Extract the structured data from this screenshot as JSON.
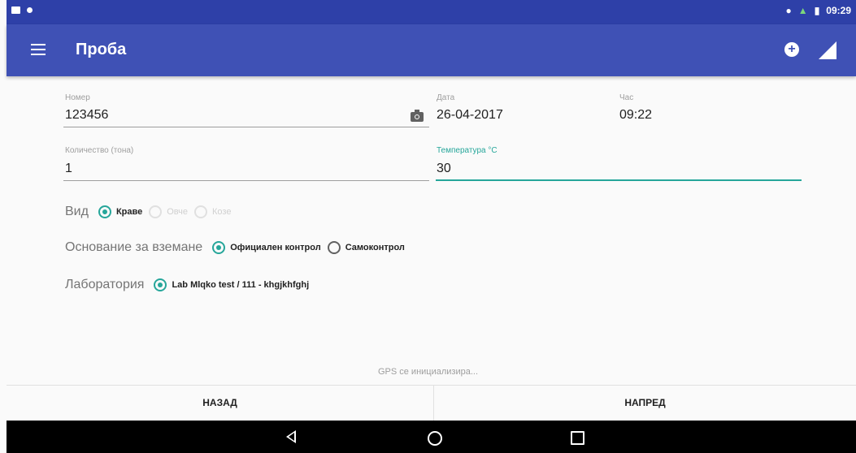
{
  "status_bar": {
    "time": "09:29"
  },
  "app_bar": {
    "title": "Проба"
  },
  "fields": {
    "number": {
      "label": "Номер",
      "value": "123456"
    },
    "date": {
      "label": "Дата",
      "value": "26-04-2017"
    },
    "hour": {
      "label": "Час",
      "value": "09:22"
    },
    "quantity": {
      "label": "Количество (тона)",
      "value": "1"
    },
    "temperature": {
      "label": "Температура °C",
      "value": "30"
    }
  },
  "kind": {
    "label": "Вид",
    "options": [
      "Краве",
      "Овче",
      "Козе"
    ],
    "selected": "Краве"
  },
  "basis": {
    "label": "Основание за вземане",
    "options": [
      "Официален контрол",
      "Самоконтрол"
    ],
    "selected": "Официален контрол"
  },
  "laboratory": {
    "label": "Лаборатория",
    "options": [
      "Lab Mlqko test / 111 - khgjkhfghj"
    ],
    "selected": "Lab Mlqko test / 111 - khgjkhfghj"
  },
  "gps_status": "GPS се инициализира...",
  "buttons": {
    "back": "НАЗАД",
    "next": "НАПРЕД"
  },
  "colors": {
    "app_bar": "#3f51b5",
    "status_bar": "#2e40a8",
    "accent": "#26a69a"
  }
}
